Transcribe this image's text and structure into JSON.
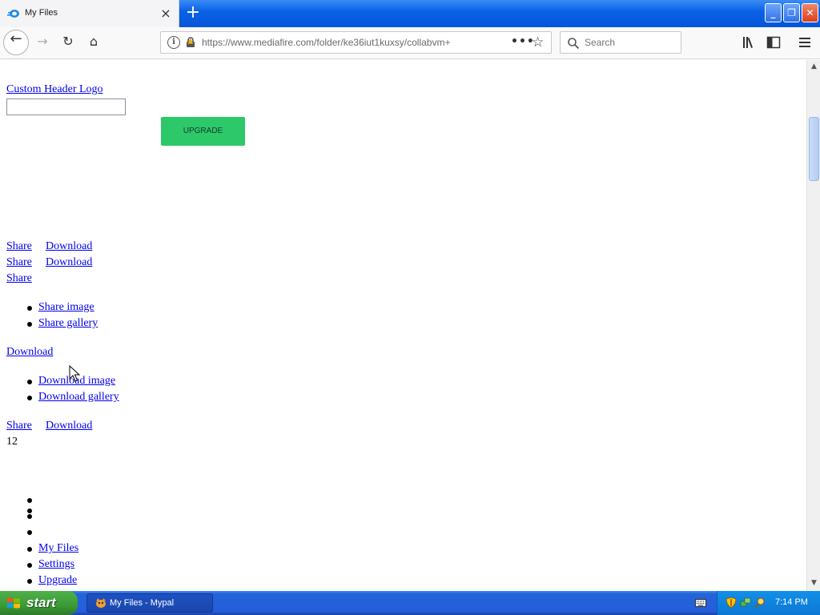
{
  "browser": {
    "tab_title": "My Files",
    "tab_close": "×",
    "new_tab": "+",
    "url": "https://www.mediafire.com/folder/ke36iut1kuxsy/collabvm+",
    "search_placeholder": "Search",
    "window_buttons": {
      "minimize": "_",
      "maximize": "❐",
      "close": "✕"
    },
    "nav": {
      "back": "←",
      "forward": "→",
      "reload": "↻",
      "home": "⌂"
    },
    "page_actions": "•••",
    "bookmark_star": "☆"
  },
  "page": {
    "header_logo_link": "Custom Header Logo",
    "upgrade_button": "UPGRADE",
    "share_label": "Share",
    "download_label": "Download",
    "share_menu": [
      "Share image",
      "Share gallery"
    ],
    "download_menu": [
      "Download image",
      "Download gallery"
    ],
    "count": "12",
    "footer_nav": [
      "My Files",
      "Settings",
      "Upgrade"
    ]
  },
  "taskbar": {
    "start_label": "start",
    "task_item": "My Files - Mypal",
    "clock": "7:14 PM"
  },
  "colors": {
    "upgrade_green": "#2dc86a",
    "link_blue": "#0000ee",
    "xp_taskbar_blue": "#245edb",
    "xp_start_green": "#3c9a37"
  }
}
